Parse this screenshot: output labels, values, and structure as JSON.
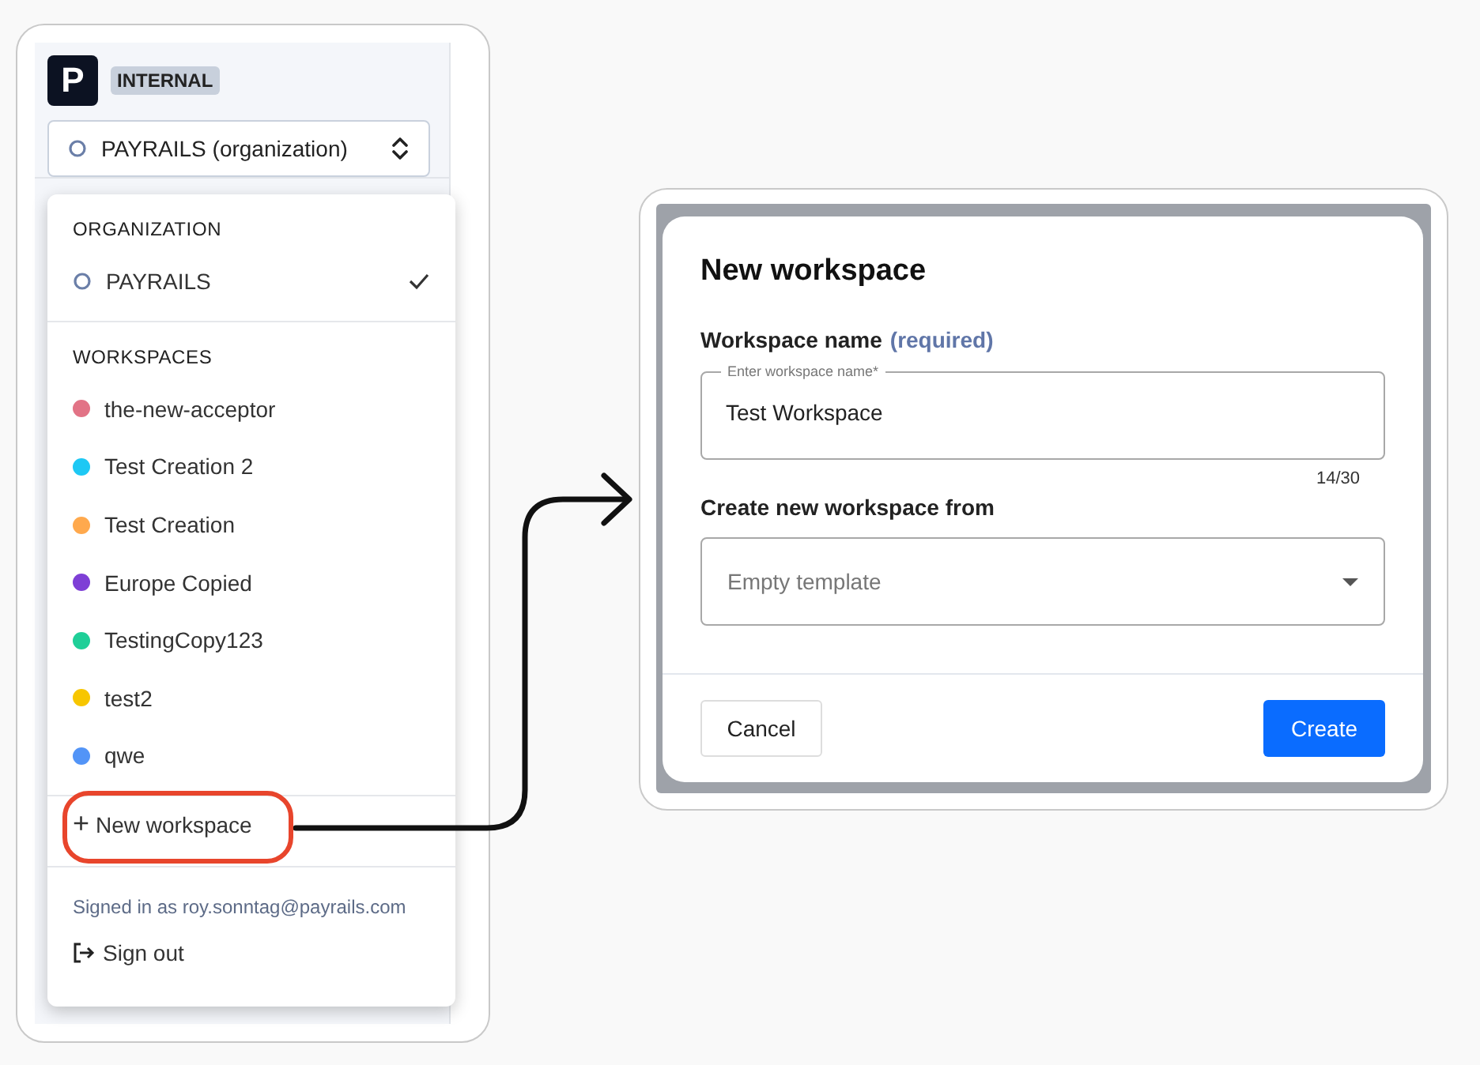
{
  "sidebar": {
    "logo": "P",
    "badge": "INTERNAL",
    "selector": {
      "label": "PAYRAILS (organization)"
    }
  },
  "menu": {
    "sections": [
      {
        "heading": "ORGANIZATION",
        "items": [
          {
            "kind": "organization",
            "label": "PAYRAILS",
            "selected": true
          }
        ]
      },
      {
        "heading": "WORKSPACES",
        "items": [
          {
            "kind": "workspace",
            "label": "the-new-acceptor",
            "color": "#e27386",
            "selected": false
          },
          {
            "kind": "workspace",
            "label": "Test Creation 2",
            "color": "#1ec8f4",
            "selected": false
          },
          {
            "kind": "workspace",
            "label": "Test Creation",
            "color": "#ffa94d",
            "selected": false
          },
          {
            "kind": "workspace",
            "label": "Europe Copied",
            "color": "#7e3fd6",
            "selected": false
          },
          {
            "kind": "workspace",
            "label": "TestingCopy123",
            "color": "#1fcf98",
            "selected": false
          },
          {
            "kind": "workspace",
            "label": "test2",
            "color": "#f7c600",
            "selected": false
          },
          {
            "kind": "workspace",
            "label": "qwe",
            "color": "#5294f7",
            "selected": false
          }
        ]
      }
    ],
    "new_workspace": {
      "icon": "+",
      "label": "New workspace"
    },
    "signed_in": "Signed in as roy.sonntag@payrails.com",
    "sign_out": "Sign out"
  },
  "dialog": {
    "title": "New workspace",
    "name_label": "Workspace name",
    "name_required": "(required)",
    "name_field": {
      "floating_label": "Enter workspace name*",
      "value": "Test Workspace"
    },
    "counter": "14/30",
    "source_label": "Create new workspace from",
    "source_select": {
      "placeholder": "Empty template"
    },
    "buttons": [
      {
        "kind": "secondary",
        "label": "Cancel"
      },
      {
        "kind": "primary",
        "label": "Create"
      }
    ]
  }
}
